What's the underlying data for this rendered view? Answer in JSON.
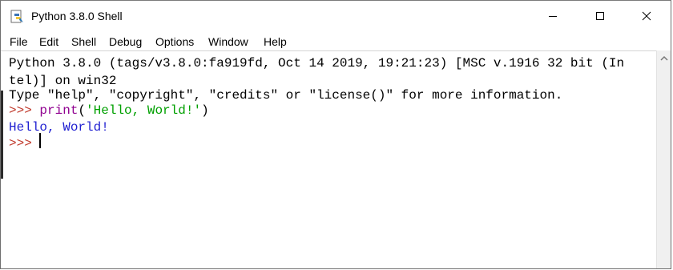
{
  "window": {
    "title": "Python 3.8.0 Shell",
    "icon": "python-idle-icon",
    "controls": {
      "minimize_icon": "minimize-icon",
      "maximize_icon": "maximize-icon",
      "close_icon": "close-icon"
    }
  },
  "menubar": {
    "items": [
      {
        "label": "File"
      },
      {
        "label": "Edit"
      },
      {
        "label": "Shell"
      },
      {
        "label": "Debug"
      },
      {
        "label": "Options"
      },
      {
        "label": "Window"
      },
      {
        "label": "Help"
      }
    ]
  },
  "shell": {
    "banner_line1": "Python 3.8.0 (tags/v3.8.0:fa919fd, Oct 14 2019, 19:21:23) [MSC v.1916 32 bit (In",
    "banner_line2": "tel)] on win32",
    "banner_line3": "Type \"help\", \"copyright\", \"credits\" or \"license()\" for more information.",
    "prompt": ">>> ",
    "command_builtin": "print",
    "command_open": "(",
    "command_string": "'Hello, World!'",
    "command_close": ")",
    "output": "Hello, World!",
    "prompt2": ">>> "
  },
  "colors": {
    "prompt": "#c0392b",
    "builtin": "#900090",
    "string": "#00a000",
    "output": "#1f1fd1"
  },
  "scrollbar": {
    "up_icon": "scroll-up-arrow-icon"
  }
}
